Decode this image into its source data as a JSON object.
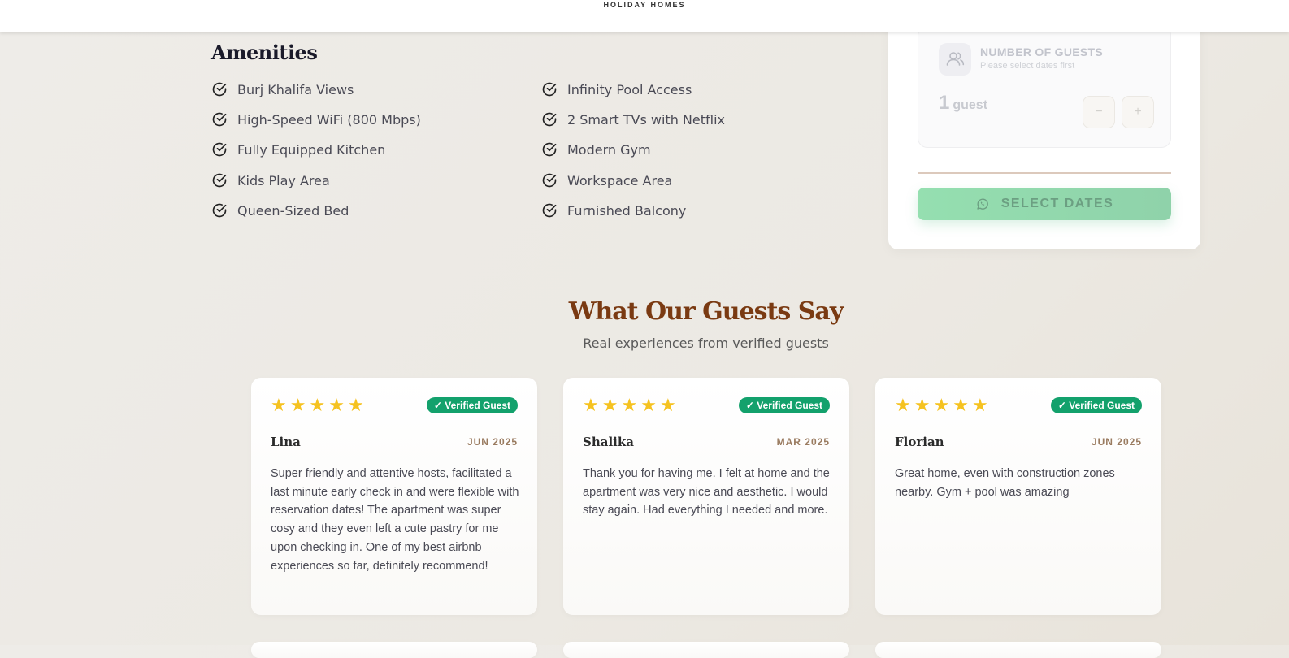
{
  "header": {
    "brand": "HOLIDAY HOMES"
  },
  "amenities": {
    "title": "Amenities",
    "left": [
      "Burj Khalifa Views",
      "High-Speed WiFi (800 Mbps)",
      "Fully Equipped Kitchen",
      "Kids Play Area",
      "Queen-Sized Bed"
    ],
    "right": [
      "Infinity Pool Access",
      "2 Smart TVs with Netflix",
      "Modern Gym",
      "Workspace Area",
      "Furnished Balcony"
    ]
  },
  "booking": {
    "guests_label": "NUMBER OF GUESTS",
    "guests_hint": "Please select dates first",
    "guest_count": "1",
    "guest_unit": "guest",
    "minus": "−",
    "plus": "+",
    "select_dates": "SELECT DATES"
  },
  "reviews": {
    "title": "What Our Guests Say",
    "subtitle": "Real experiences from verified guests",
    "badge": "✓ Verified Guest",
    "rating": 5,
    "items": [
      {
        "name": "Lina",
        "date": "JUN 2025",
        "text": "Super friendly and attentive hosts, facilitated a last minute early check in and were flexible with reservation dates! The apartment was super cosy and they even left a cute pastry for me upon checking in. One of my best airbnb experiences so far, definitely recommend!"
      },
      {
        "name": "Shalika",
        "date": "MAR 2025",
        "text": "Thank you for having me. I felt at home and the apartment was very nice and aesthetic. I would stay again. Had everything I needed and more."
      },
      {
        "name": "Florian",
        "date": "JUN 2025",
        "text": "Great home, even with construction zones nearby. Gym + pool was amazing"
      }
    ]
  },
  "colors": {
    "accent_title": "#7a3a12",
    "verified_badge": "#13a16c",
    "star": "#f5c220",
    "select_button": "#95dfb0"
  },
  "icons": {
    "amenity": "check-circle-icon",
    "guests": "users-icon",
    "select": "whatsapp-icon",
    "rating": "star-icon"
  }
}
